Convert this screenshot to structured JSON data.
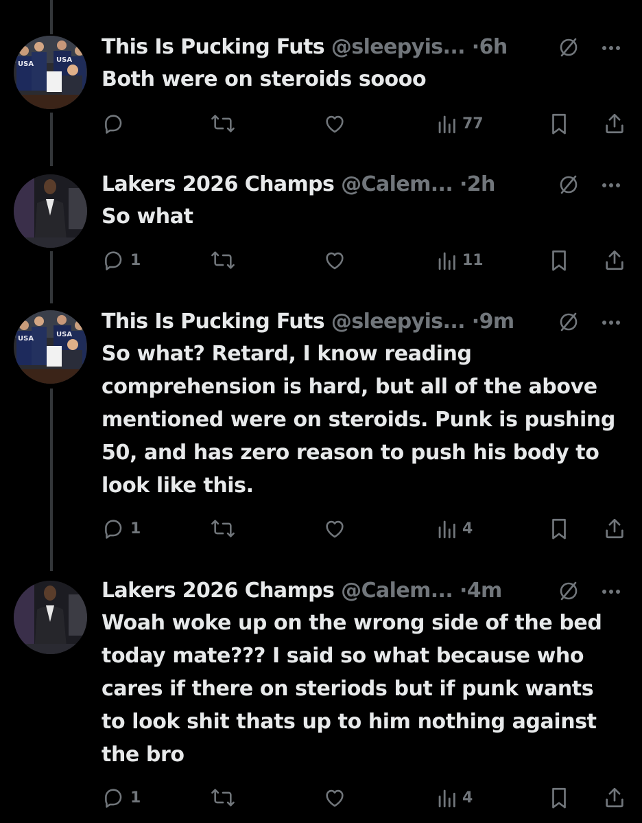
{
  "colors": {
    "background": "#000000",
    "primary_text": "#e7e9ea",
    "secondary_text": "#71767b",
    "thread_line": "#333639"
  },
  "tweets": [
    {
      "display_name": "This Is Pucking Futs",
      "handle": "@sleepyis...",
      "separator": "·",
      "time": "6h",
      "text": "Both were on steroids soooo",
      "replies": "",
      "views": "77",
      "avatar": "usa-team-photo"
    },
    {
      "display_name": "Lakers 2026 Champs",
      "handle": "@Calem...",
      "separator": "·",
      "time": "2h",
      "text": "So what",
      "replies": "1",
      "views": "11",
      "avatar": "man-in-suit-photo"
    },
    {
      "display_name": "This Is Pucking Futs",
      "handle": "@sleepyis...",
      "separator": "·",
      "time": "9m",
      "text": "So what? Retard, I know reading comprehension is hard, but all of the above mentioned were on steroids. Punk is pushing 50, and has zero reason to push his body to look like this.",
      "replies": "1",
      "views": "4",
      "avatar": "usa-team-photo"
    },
    {
      "display_name": "Lakers 2026 Champs",
      "handle": "@Calem...",
      "separator": "·",
      "time": "4m",
      "text": "Woah woke up on the wrong side of the bed today mate??? I said so what because who cares if there on steriods but if punk wants to look shit thats up to him nothing against the bro",
      "replies": "1",
      "views": "4",
      "avatar": "man-in-suit-photo"
    }
  ]
}
